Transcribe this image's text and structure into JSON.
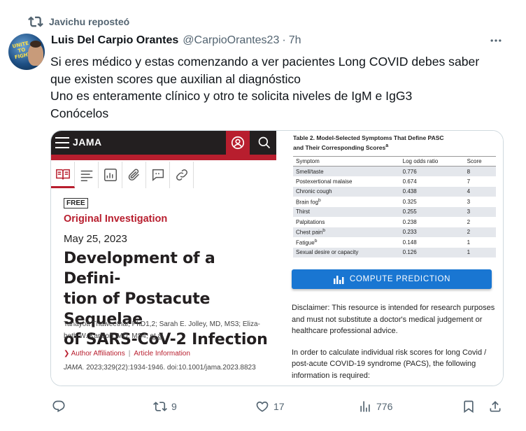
{
  "repost": {
    "label": "Javichu reposteó",
    "icon": "repost-icon"
  },
  "author": {
    "name": "Luis Del Carpio Orantes",
    "handle": "@CarpioOrantes23",
    "separator": "·",
    "time": "7h",
    "avatar_text": "UNITE TO FIGHT"
  },
  "tweet": {
    "lines": [
      "Si eres médico y estas comenzando a ver pacientes Long COVID debes saber",
      "que existen scores que auxilian al diagnóstico",
      "Uno es enteramente clínico y otro te solicita niveles de IgM e IgG3",
      "Conócelos"
    ]
  },
  "article": {
    "brand": "JAMA",
    "free": "FREE",
    "type": "Original Investigation",
    "date": "May 25, 2023",
    "title_lines": [
      "Development of a Defini-",
      "tion of Postacute Sequelae",
      "of SARS-CoV-2 Infection"
    ],
    "authors_line1": "Tanayott Thaweethai, PhD1,2; Sarah E. Jolley, MD, MS3; Eliza-",
    "authors_line2": "beth W. Karlson, MD, MS4;",
    "authors_etal": "et al",
    "affiliations": "Author Affiliations",
    "affil_sep": "|",
    "article_info": "Article Information",
    "journal": "JAMA.",
    "citation": "2023;329(22):1934-1946. doi:10.1001/jama.2023.8823"
  },
  "table": {
    "title_line1": "Table 2. Model-Selected Symptoms That Define PASC",
    "title_line2": "and Their Corresponding Scores",
    "headers": [
      "Symptom",
      "Log odds ratio",
      "Score"
    ],
    "rows": [
      [
        "Smell/taste",
        "0.776",
        "8"
      ],
      [
        "Postexertional malaise",
        "0.674",
        "7"
      ],
      [
        "Chronic cough",
        "0.438",
        "4"
      ],
      [
        "Brain fog",
        "0.325",
        "3"
      ],
      [
        "Thirst",
        "0.255",
        "3"
      ],
      [
        "Palpitations",
        "0.238",
        "2"
      ],
      [
        "Chest pain",
        "0.233",
        "2"
      ],
      [
        "Fatigue",
        "0.148",
        "1"
      ],
      [
        "Sexual desire or capacity",
        "0.126",
        "1"
      ]
    ]
  },
  "calculator": {
    "button": "COMPUTE PREDICTION",
    "disclaimer": "Disclaimer: This resource is intended for research purposes and must not substitute a doctor's medical judgement or healthcare professional advice.",
    "info": "In order to calculate individual risk scores for long Covid / post-acute COVID-19 syndrome (PACS), the following information is required:"
  },
  "stats": {
    "replies": "",
    "reposts": "9",
    "likes": "17",
    "views": "776"
  },
  "colors": {
    "accent": "#1d9bf0",
    "jama_red": "#b81e2e",
    "muted": "#536471",
    "button_blue": "#1976d2"
  }
}
